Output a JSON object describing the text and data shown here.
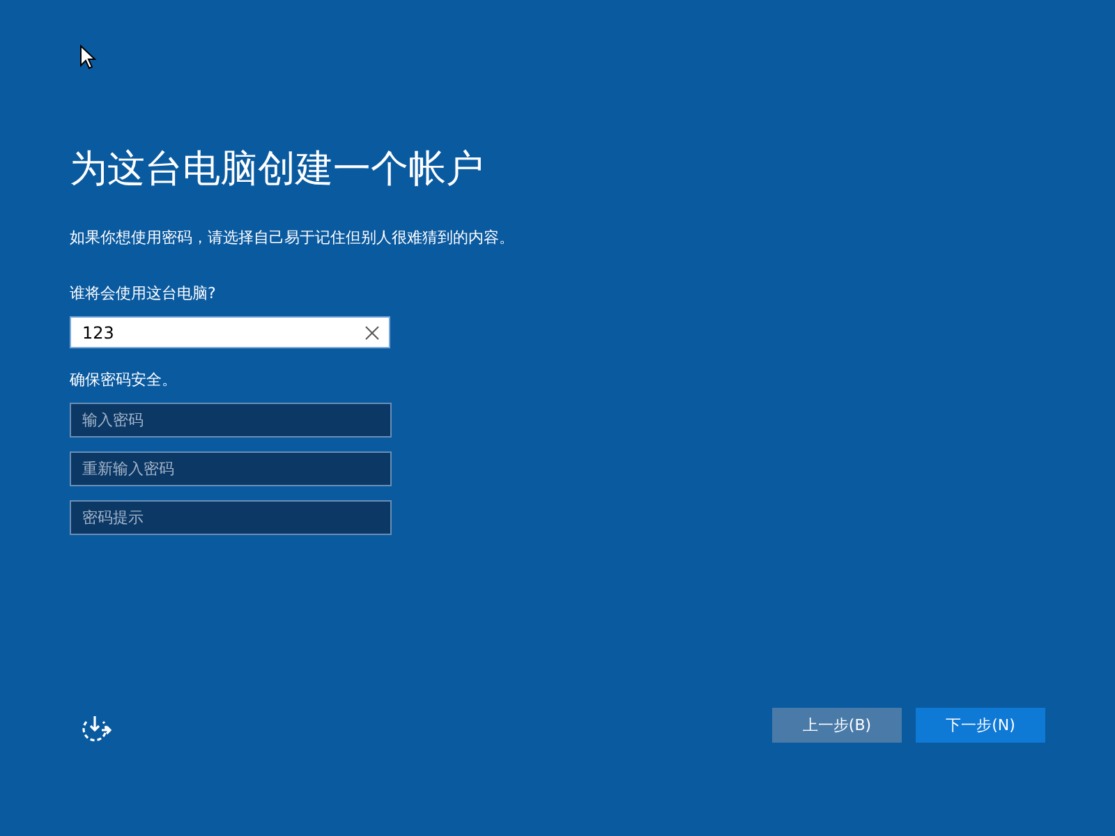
{
  "title": "为这台电脑创建一个帐户",
  "subtitle": "如果你想使用密码，请选择自己易于记住但别人很难猜到的内容。",
  "user": {
    "label": "谁将会使用这台电脑?",
    "value": "123"
  },
  "password": {
    "label": "确保密码安全。",
    "fields": [
      {
        "placeholder": "输入密码"
      },
      {
        "placeholder": "重新输入密码"
      },
      {
        "placeholder": "密码提示"
      }
    ]
  },
  "buttons": [
    {
      "label": "上一步(B)",
      "disabled": true
    },
    {
      "label": "下一步(N)",
      "disabled": false
    }
  ]
}
